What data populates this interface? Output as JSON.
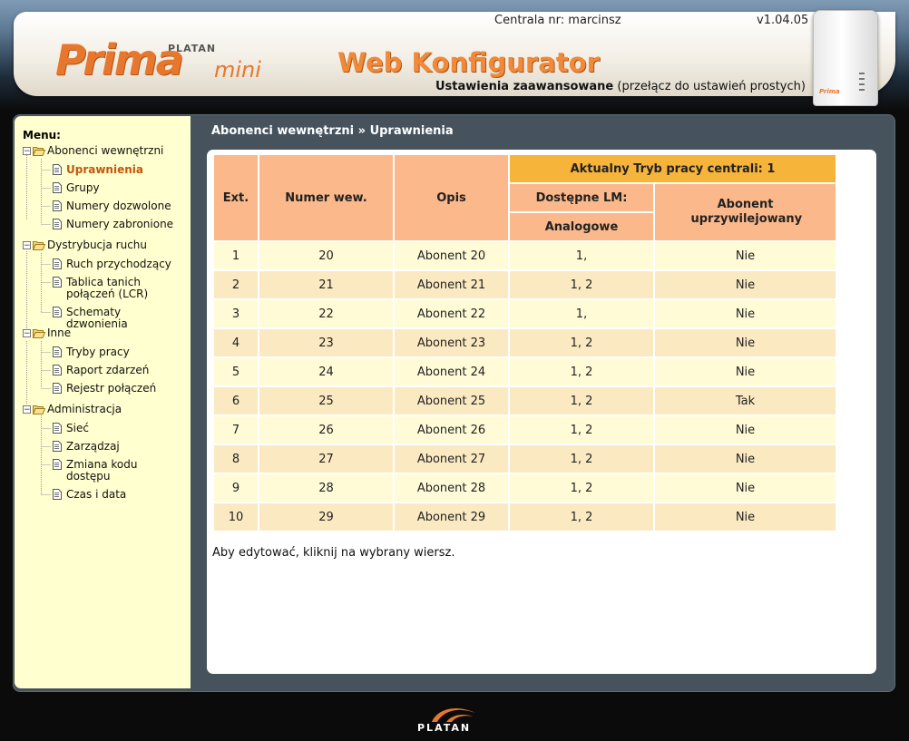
{
  "header": {
    "logo": {
      "brand": "PLATAN",
      "product": "Prima",
      "variant": "mini"
    },
    "app_title": "Web Konfigurator",
    "central_label": "Centrala nr: marcinsz",
    "version": "v1.04.05",
    "mode_current": "Ustawienia zaawansowane",
    "mode_toggle": "(przełącz do ustawień prostych)",
    "device_brand": "Prima"
  },
  "sidebar": {
    "title": "Menu:",
    "sections": [
      {
        "label": "Abonenci wewnętrzni",
        "items": [
          {
            "label": "Uprawnienia",
            "active": true
          },
          {
            "label": "Grupy"
          },
          {
            "label": "Numery dozwolone"
          },
          {
            "label": "Numery zabronione"
          }
        ]
      },
      {
        "label": "Dystrybucja ruchu",
        "items": [
          {
            "label": "Ruch przychodzący"
          },
          {
            "label": "Tablica tanich połączeń (LCR)"
          },
          {
            "label": "Schematy dzwonienia"
          }
        ]
      },
      {
        "label": "Inne",
        "items": [
          {
            "label": "Tryby pracy"
          },
          {
            "label": "Raport zdarzeń"
          },
          {
            "label": "Rejestr połączeń"
          }
        ]
      },
      {
        "label": "Administracja",
        "items": [
          {
            "label": "Sieć"
          },
          {
            "label": "Zarządzaj"
          },
          {
            "label": "Zmiana kodu dostępu"
          },
          {
            "label": "Czas i data"
          }
        ]
      }
    ]
  },
  "content": {
    "breadcrumb": "Abonenci wewnętrzni » Uprawnienia",
    "table": {
      "headers": {
        "ext": "Ext.",
        "number": "Numer wew.",
        "desc": "Opis",
        "mode": "Aktualny Tryb pracy centrali: 1",
        "lines": "Dostępne LM:",
        "analog": "Analogowe",
        "privileged": "Abonent uprzywilejowany"
      },
      "rows": [
        {
          "ext": "1",
          "number": "20",
          "desc": "Abonent 20",
          "lines": "1,",
          "privileged": "Nie"
        },
        {
          "ext": "2",
          "number": "21",
          "desc": "Abonent 21",
          "lines": "1, 2",
          "privileged": "Nie"
        },
        {
          "ext": "3",
          "number": "22",
          "desc": "Abonent 22",
          "lines": "1,",
          "privileged": "Nie"
        },
        {
          "ext": "4",
          "number": "23",
          "desc": "Abonent 23",
          "lines": "1, 2",
          "privileged": "Nie"
        },
        {
          "ext": "5",
          "number": "24",
          "desc": "Abonent 24",
          "lines": "1, 2",
          "privileged": "Nie"
        },
        {
          "ext": "6",
          "number": "25",
          "desc": "Abonent 25",
          "lines": "1, 2",
          "privileged": "Tak"
        },
        {
          "ext": "7",
          "number": "26",
          "desc": "Abonent 26",
          "lines": "1, 2",
          "privileged": "Nie"
        },
        {
          "ext": "8",
          "number": "27",
          "desc": "Abonent 27",
          "lines": "1, 2",
          "privileged": "Nie"
        },
        {
          "ext": "9",
          "number": "28",
          "desc": "Abonent 28",
          "lines": "1, 2",
          "privileged": "Nie"
        },
        {
          "ext": "10",
          "number": "29",
          "desc": "Abonent 29",
          "lines": "1, 2",
          "privileged": "Nie"
        }
      ]
    },
    "hint": "Aby edytować, kliknij na wybrany wiersz."
  },
  "footer": {
    "logo_text": "PLATAN"
  },
  "colors": {
    "accent": "#e8772e",
    "header_cell": "#fbb88a",
    "mode_cell": "#f7b43a",
    "row_odd": "#fffbd7",
    "row_even": "#fbeac1"
  }
}
